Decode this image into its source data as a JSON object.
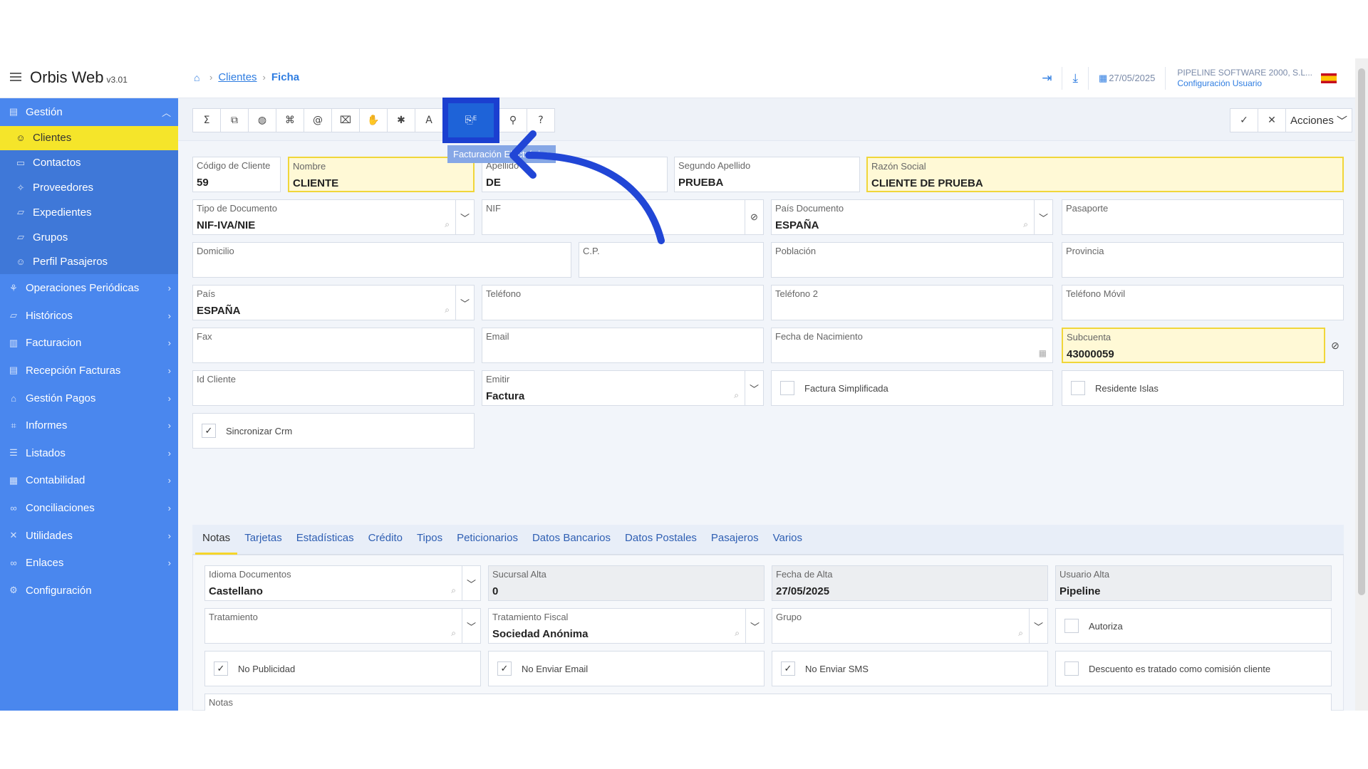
{
  "app": {
    "name": "Orbis Web",
    "version": "v3.01"
  },
  "breadcrumb": {
    "parent": "Clientes",
    "current": "Ficha"
  },
  "header": {
    "date": "27/05/2025",
    "company": "PIPELINE SOFTWARE 2000, S.L...",
    "user_config": "Configuración Usuario"
  },
  "sidebar": {
    "gestion": "Gestión",
    "sub": [
      "Clientes",
      "Contactos",
      "Proveedores",
      "Expedientes",
      "Grupos",
      "Perfil Pasajeros"
    ],
    "items": [
      "Operaciones Periódicas",
      "Históricos",
      "Facturacion",
      "Recepción Facturas",
      "Gestión Pagos",
      "Informes",
      "Listados",
      "Contabilidad",
      "Conciliaciones",
      "Utilidades",
      "Enlaces",
      "Configuración"
    ]
  },
  "toolbar": {
    "tooltip": "Facturación Electrónica",
    "actions": "Acciones"
  },
  "form": {
    "codigo": {
      "label": "Código de Cliente",
      "value": "59"
    },
    "nombre": {
      "label": "Nombre",
      "value": "CLIENTE"
    },
    "apellido": {
      "label": "Apellido",
      "value": "DE"
    },
    "segundo": {
      "label": "Segundo Apellido",
      "value": "PRUEBA"
    },
    "razon": {
      "label": "Razón Social",
      "value": "CLIENTE DE PRUEBA"
    },
    "tipodoc": {
      "label": "Tipo de Documento",
      "value": "NIF-IVA/NIE"
    },
    "nif": {
      "label": "NIF",
      "value": ""
    },
    "paisdoc": {
      "label": "País Documento",
      "value": "ESPAÑA"
    },
    "pasaporte": {
      "label": "Pasaporte",
      "value": ""
    },
    "domicilio": {
      "label": "Domicilio",
      "value": ""
    },
    "cp": {
      "label": "C.P.",
      "value": ""
    },
    "poblacion": {
      "label": "Población",
      "value": ""
    },
    "provincia": {
      "label": "Provincia",
      "value": ""
    },
    "pais": {
      "label": "País",
      "value": "ESPAÑA"
    },
    "telefono": {
      "label": "Teléfono",
      "value": ""
    },
    "telefono2": {
      "label": "Teléfono 2",
      "value": ""
    },
    "movil": {
      "label": "Teléfono Móvil",
      "value": ""
    },
    "fax": {
      "label": "Fax",
      "value": ""
    },
    "email": {
      "label": "Email",
      "value": ""
    },
    "nacimiento": {
      "label": "Fecha de Nacimiento",
      "value": ""
    },
    "subcuenta": {
      "label": "Subcuenta",
      "value": "43000059"
    },
    "idcliente": {
      "label": "Id Cliente",
      "value": ""
    },
    "emitir": {
      "label": "Emitir",
      "value": "Factura"
    },
    "simplificada": "Factura Simplificada",
    "residente": "Residente Islas",
    "sincronizar": "Sincronizar Crm"
  },
  "tabs": [
    "Notas",
    "Tarjetas",
    "Estadísticas",
    "Crédito",
    "Tipos",
    "Peticionarios",
    "Datos Bancarios",
    "Datos Postales",
    "Pasajeros",
    "Varios"
  ],
  "notas": {
    "idioma": {
      "label": "Idioma Documentos",
      "value": "Castellano"
    },
    "sucursal": {
      "label": "Sucursal Alta",
      "value": "0"
    },
    "fechaalta": {
      "label": "Fecha de Alta",
      "value": "27/05/2025"
    },
    "usuario": {
      "label": "Usuario Alta",
      "value": "Pipeline"
    },
    "tratamiento": {
      "label": "Tratamiento",
      "value": ""
    },
    "fiscal": {
      "label": "Tratamiento Fiscal",
      "value": "Sociedad Anónima"
    },
    "grupo": {
      "label": "Grupo",
      "value": ""
    },
    "autoriza": "Autoriza",
    "nopublicidad": "No Publicidad",
    "noemail": "No Enviar Email",
    "nosms": "No Enviar SMS",
    "descuento": "Descuento es tratado como comisión cliente",
    "notas": {
      "label": "Notas",
      "value": ""
    }
  }
}
